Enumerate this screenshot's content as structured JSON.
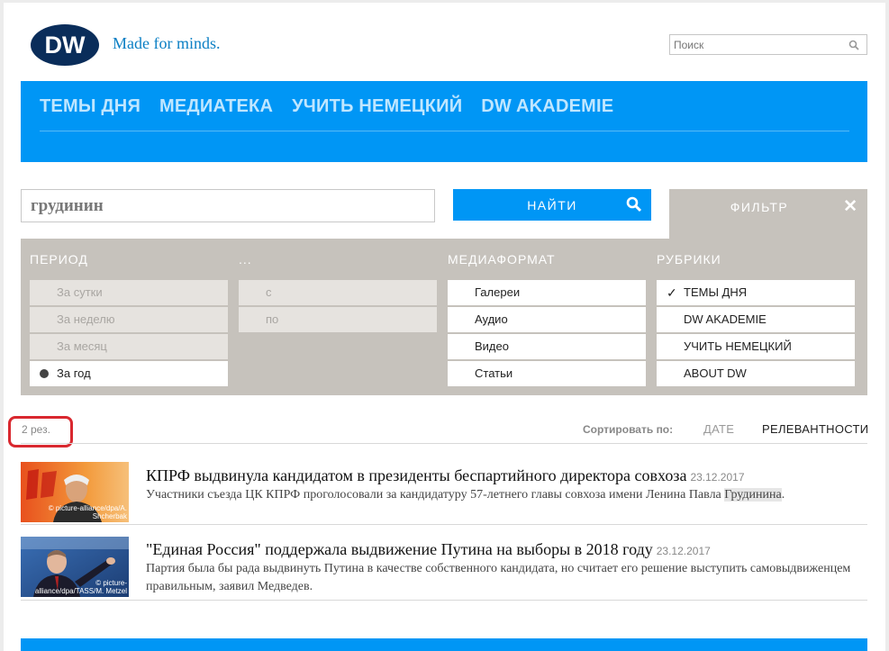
{
  "header": {
    "tagline": "Made for minds.",
    "search_placeholder": "Поиск"
  },
  "nav": {
    "items": [
      {
        "label": "ТЕМЫ ДНЯ"
      },
      {
        "label": "МЕДИАТЕКА"
      },
      {
        "label": "УЧИТЬ НЕМЕЦКИЙ"
      },
      {
        "label": "DW AKADEMIE"
      }
    ]
  },
  "search": {
    "query": "грудинин",
    "find_label": "НАЙТИ",
    "filter_label": "ФИЛЬТР",
    "close_symbol": "✕"
  },
  "filters": {
    "period": {
      "title": "ПЕРИОД",
      "options": [
        {
          "label": "За сутки",
          "selected": false
        },
        {
          "label": "За неделю",
          "selected": false
        },
        {
          "label": "За месяц",
          "selected": false
        },
        {
          "label": "За год",
          "selected": true
        }
      ]
    },
    "custom": {
      "title": "...",
      "options": [
        {
          "label": "с"
        },
        {
          "label": "по"
        }
      ]
    },
    "media": {
      "title": "МЕДИАФОРМАТ",
      "options": [
        {
          "label": "Галереи"
        },
        {
          "label": "Аудио"
        },
        {
          "label": "Видео"
        },
        {
          "label": "Статьи"
        }
      ]
    },
    "rubrics": {
      "title": "РУБРИКИ",
      "options": [
        {
          "label": "ТЕМЫ ДНЯ",
          "checked": true
        },
        {
          "label": "DW AKADEMIE",
          "checked": false
        },
        {
          "label": "УЧИТЬ НЕМЕЦКИЙ",
          "checked": false
        },
        {
          "label": "ABOUT DW",
          "checked": false
        }
      ]
    }
  },
  "results_bar": {
    "count": "2 рез.",
    "sort_label": "Сортировать по:",
    "sort_date": "ДАТЕ",
    "sort_relevance": "РЕЛЕВАНТНОСТИ"
  },
  "results": [
    {
      "title": "КПРФ выдвинула кандидатом в президенты беспартийного директора совхоза",
      "date": "23.12.2017",
      "snippet_before": "Участники съезда ЦК КПРФ проголосовали за кандидатуру 57-летнего главы совхоза имени Ленина Павла ",
      "snippet_highlight": "Грудинина",
      "snippet_after": ".",
      "credit": "© picture-alliance/dpa/A. Shcherbak"
    },
    {
      "title": "\"Единая Россия\" поддержала выдвижение Путина на выборы в 2018 году",
      "date": "23.12.2017",
      "snippet_before": "Партия была бы рада выдвинуть Путина в качестве собственного кандидата, но считает его решение выступить самовыдвиженцем правильным, заявил Медведев.",
      "snippet_highlight": "",
      "snippet_after": "",
      "credit": "© picture-alliance/dpa/TASS/M. Metzel"
    }
  ],
  "colors": {
    "brand_blue": "#0096f5",
    "logo_navy": "#0a2d5a",
    "filter_gray": "#c6c2bc",
    "highlight_red": "#d9282f"
  }
}
